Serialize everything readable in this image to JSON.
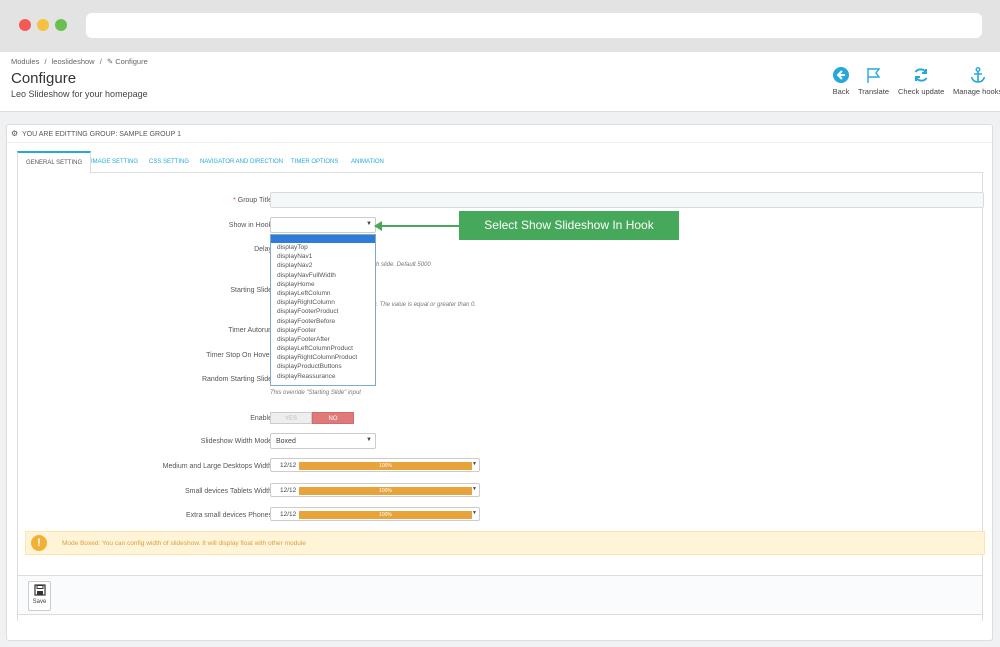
{
  "breadcrumb": [
    "Modules",
    "/",
    "leoslideshow",
    "/",
    "✎ Configure"
  ],
  "page": {
    "title": "Configure",
    "subtitle": "Leo Slideshow for your homepage"
  },
  "toolbar": [
    {
      "label": "Back",
      "icon": "back-arrow-icon"
    },
    {
      "label": "Translate",
      "icon": "flag-icon"
    },
    {
      "label": "Check update",
      "icon": "refresh-icon"
    },
    {
      "label": "Manage hooks",
      "icon": "anchor-icon"
    }
  ],
  "panel": {
    "heading": "YOU ARE EDITTING GROUP: SAMPLE GROUP 1"
  },
  "tabs": [
    "GENERAL SETTING",
    "IMAGE SETTING",
    "CSS SETTING",
    "NAVIGATOR AND DIRECTION",
    "TIMER OPTIONS",
    "ANIMATION"
  ],
  "form": {
    "group_title": {
      "label": "Group Title",
      "required": "*",
      "value": ""
    },
    "show_in_hook": {
      "label": "Show in Hook",
      "value": ""
    },
    "delay": {
      "label": "Delay",
      "help": "ch slide. Default 5000"
    },
    "starting_slide": {
      "label": "Starting Slide",
      "help": "0. The value is equal or greater than 0."
    },
    "timer_autorun": {
      "label": "Timer Autorun"
    },
    "timer_stop_on_hover": {
      "label": "Timer Stop On Hover"
    },
    "random_starting_slide": {
      "label": "Random Starting Slide",
      "help": "This override \"Starting Slide\" input"
    },
    "enable": {
      "label": "Enable",
      "yes": "YES",
      "no": "NO",
      "selected": "NO"
    },
    "slideshow_width_mode": {
      "label": "Slideshow Width Mode",
      "value": "Boxed"
    },
    "widths": [
      {
        "label": "Medium and Large Desktops Width",
        "value": "12/12",
        "percent": "100%"
      },
      {
        "label": "Small devices Tablets Width",
        "value": "12/12",
        "percent": "100%"
      },
      {
        "label": "Extra small devices Phones",
        "value": "12/12",
        "percent": "100%"
      }
    ]
  },
  "hook_options": [
    "displayTop",
    "displayNav1",
    "displayNav2",
    "displayNavFullWidth",
    "displayHome",
    "displayLeftColumn",
    "displayRightColumn",
    "displayFooterProduct",
    "displayFooterBefore",
    "displayFooter",
    "displayFooterAfter",
    "displayLeftColumnProduct",
    "displayRightColumnProduct",
    "displayProductButtons",
    "displayReassurance"
  ],
  "warning": {
    "text": "Mode Boxed: You can config width of slideshow. It will display float with other module"
  },
  "save": {
    "label": "Save"
  },
  "callout": {
    "text": "Select Show Slideshow In Hook"
  },
  "colors": {
    "accent": "#25a9d9",
    "callout": "#45a85a",
    "bar": "#e8a33a",
    "no_toggle": "#e07a7a",
    "warning_bg": "#fff4d8"
  }
}
